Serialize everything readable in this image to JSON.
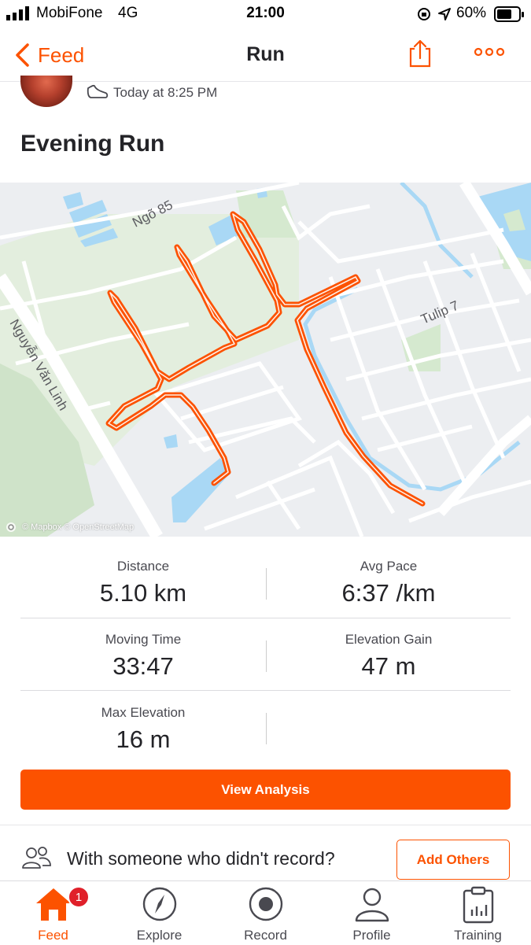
{
  "status_bar": {
    "carrier": "MobiFone",
    "network": "4G",
    "time": "21:00",
    "battery": "60%"
  },
  "nav": {
    "back_label": "Feed",
    "title": "Run"
  },
  "activity": {
    "timestamp": "Today at 8:25 PM",
    "title": "Evening Run",
    "map": {
      "street_labels": [
        "Ngõ 85",
        "Tulip 7",
        "Nguyễn Văn Linh"
      ],
      "credit": "© Mapbox © OpenStreetMap"
    }
  },
  "stats": [
    {
      "label": "Distance",
      "value": "5.10 km"
    },
    {
      "label": "Avg Pace",
      "value": "6:37 /km"
    },
    {
      "label": "Moving Time",
      "value": "33:47"
    },
    {
      "label": "Elevation Gain",
      "value": "47 m"
    },
    {
      "label": "Max Elevation",
      "value": "16 m"
    }
  ],
  "cta_label": "View Analysis",
  "others": {
    "prompt": "With someone who didn't record?",
    "button": "Add Others"
  },
  "tabs": [
    {
      "label": "Feed",
      "icon": "home-icon",
      "badge": "1"
    },
    {
      "label": "Explore",
      "icon": "compass-icon"
    },
    {
      "label": "Record",
      "icon": "record-icon"
    },
    {
      "label": "Profile",
      "icon": "profile-icon"
    },
    {
      "label": "Training",
      "icon": "training-icon"
    }
  ],
  "colors": {
    "accent": "#fc5200",
    "route": "#fc5200",
    "water": "#a9d8f5",
    "park": "#d9ecd5"
  }
}
